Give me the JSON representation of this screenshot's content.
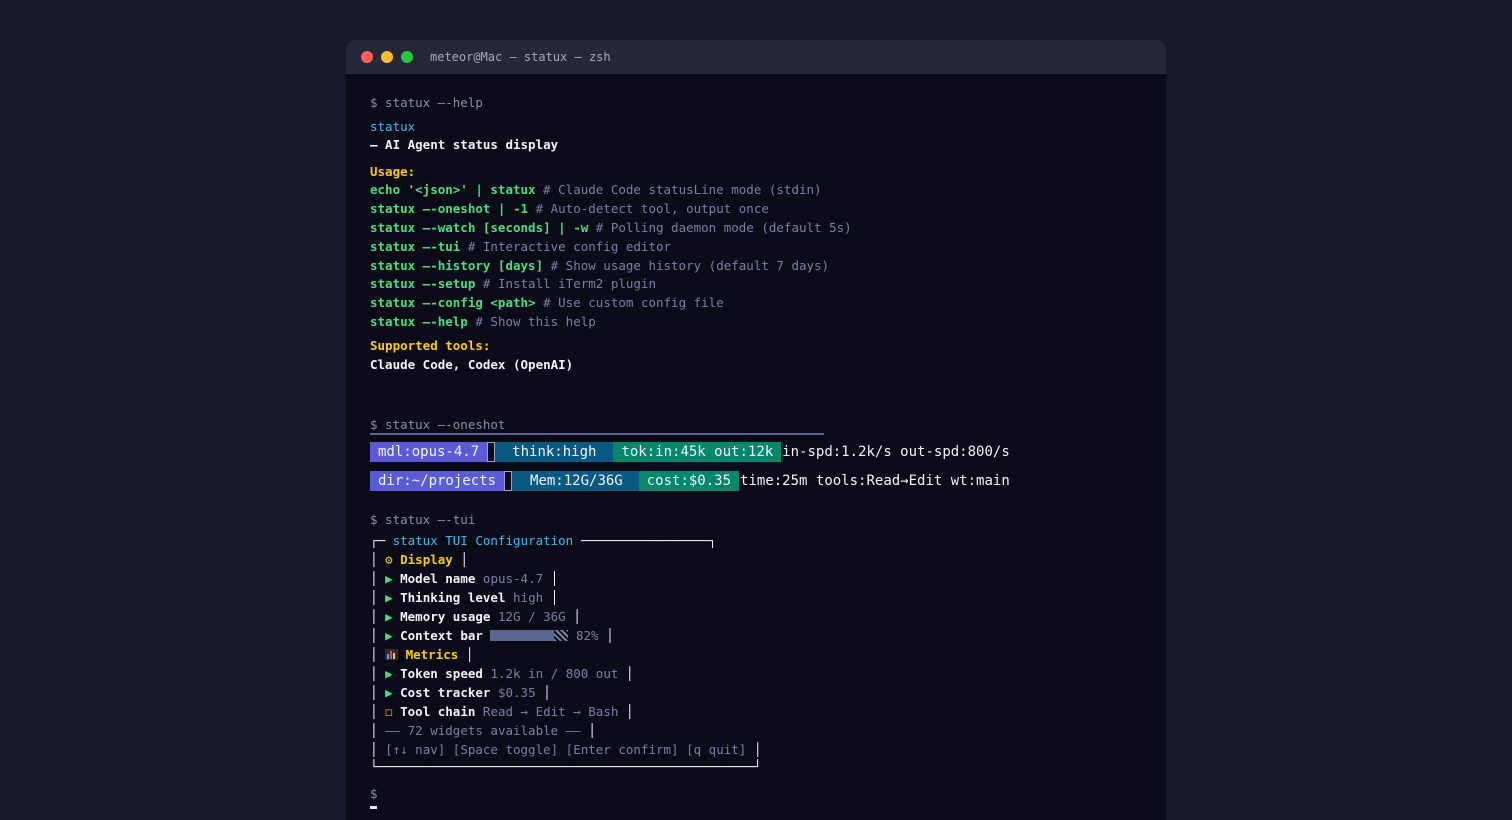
{
  "window": {
    "title": "meteor@Mac — statux — zsh"
  },
  "help": {
    "prompt": "$ statux —-help",
    "name": "statux",
    "description": "— AI Agent status display",
    "usage_heading": "Usage:",
    "usage": [
      {
        "cmd": "echo '<json>' | statux",
        "comment": "# Claude Code statusLine mode (stdin)"
      },
      {
        "cmd": "statux —-oneshot | -1",
        "comment": "# Auto-detect tool, output once"
      },
      {
        "cmd": "statux —-watch [seconds] | -w",
        "comment": "# Polling daemon mode (default 5s)"
      },
      {
        "cmd": "statux —-tui",
        "comment": "# Interactive config editor"
      },
      {
        "cmd": "statux —-history [days]",
        "comment": "# Show usage history (default 7 days)"
      },
      {
        "cmd": "statux —-setup",
        "comment": "# Install iTerm2 plugin"
      },
      {
        "cmd": "statux —-config <path>",
        "comment": "# Use custom config file"
      },
      {
        "cmd": "statux —-help",
        "comment": "# Show this help"
      }
    ],
    "tools_heading": "Supported tools:",
    "tools": "Claude Code, Codex (OpenAI)"
  },
  "oneshot": {
    "prompt": "$ statux —-oneshot",
    "row1": {
      "model": "mdl:opus-4.7",
      "think": "think:high",
      "tokens": "tok:in:45k out:12k",
      "speed": "in-spd:1.2k/s out-spd:800/s"
    },
    "row2": {
      "dir": "dir:~/projects",
      "mem": "Mem:12G/36G",
      "cost": "cost:$0.35",
      "extra": "time:25m tools:Read→Edit wt:main"
    }
  },
  "tui": {
    "prompt": "$ statux —-tui",
    "header": "┌─ statux TUI Configuration ────────────────┐",
    "header_title": "statux TUI Configuration",
    "display_label": "Display",
    "display_icon": "gear-icon",
    "items": [
      {
        "label": "Model name",
        "value": "opus-4.7"
      },
      {
        "label": "Thinking level",
        "value": "high"
      },
      {
        "label": "Memory usage",
        "value": "12G / 36G"
      },
      {
        "label": "Context bar",
        "value": "82%",
        "fill": 0.82
      }
    ],
    "metrics_label": "Metrics",
    "metrics_icon": "chart-icon",
    "metric_items": [
      {
        "label": "Token speed",
        "value": "1.2k in / 800 out"
      },
      {
        "label": "Cost tracker",
        "value": "$0.35"
      }
    ],
    "tool_chain": {
      "label": "Tool chain",
      "value": "Read → Edit → Bash"
    },
    "widgets": "—— 72 widgets available ——",
    "help": "[↑↓ nav] [Space toggle] [Enter confirm] [q quit]",
    "footer": "└──────────────────────────────────────────────────┘"
  },
  "final_prompt": "$"
}
